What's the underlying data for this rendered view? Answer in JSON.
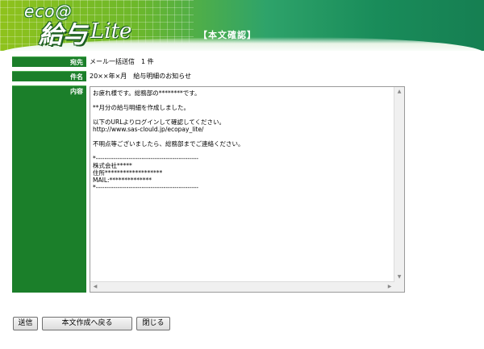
{
  "header": {
    "logo_eco": "eco@",
    "logo_main": "給与",
    "logo_lite": "Lite",
    "page_title": "【本文確認】"
  },
  "fields": {
    "to_label": "宛先",
    "to_value": "メール一括送信　1 件",
    "subject_label": "件名",
    "subject_value": "20××年×月　給与明細のお知らせ",
    "body_label": "内容"
  },
  "body_text": "お疲れ様です。総務部の********です。\n\n**月分の給与明細を作成しました。\n\n以下のURLよりログインして確認してください。\nhttp://www.sas-clould.jp/ecopay_lite/\n\n不明点等ございましたら、総務部までご連絡ください。\n\n*-----------------------------------------------\n株式会社*****\n住所*******************\nMAIL:**************\n*-----------------------------------------------",
  "buttons": {
    "send": "送信",
    "back": "本文作成へ戻る",
    "close": "閉じる"
  },
  "colors": {
    "label_bg": "#1b7f2a",
    "header_green": "#198c5a"
  }
}
